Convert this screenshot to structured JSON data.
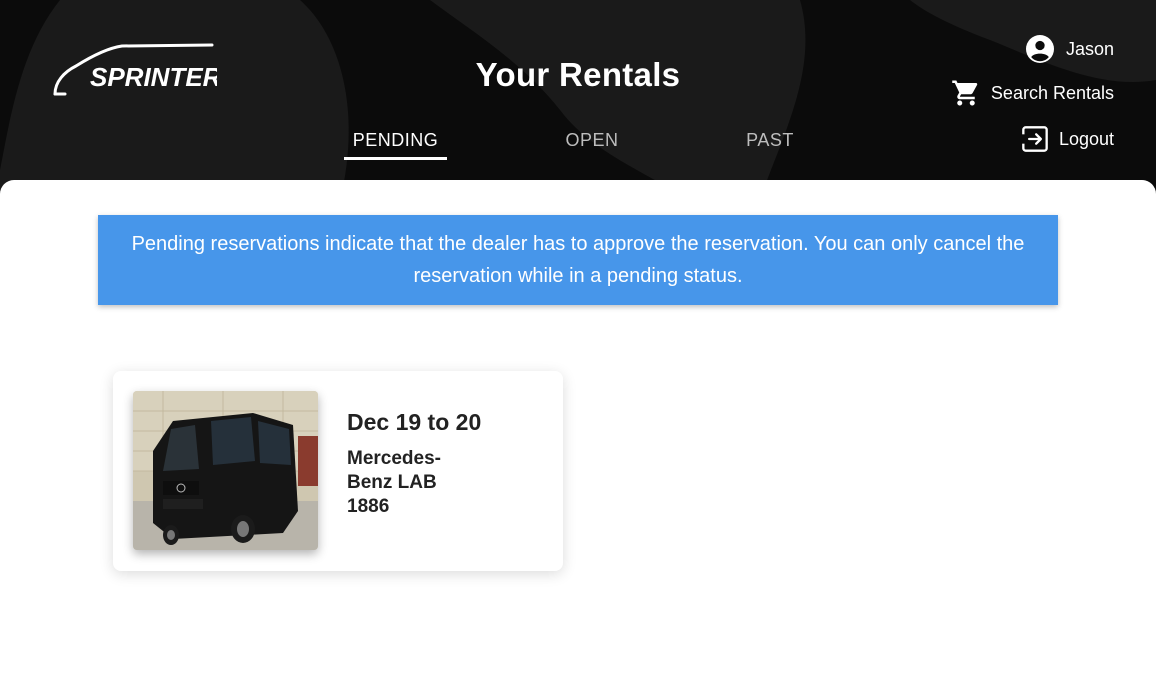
{
  "header": {
    "logo_text": "SPRINTER",
    "title": "Your Rentals",
    "background_color": "#0b0b0b",
    "blob_color": "#1a1a1a"
  },
  "tabs": {
    "items": [
      {
        "label": "PENDING",
        "active": true
      },
      {
        "label": "OPEN",
        "active": false
      },
      {
        "label": "PAST",
        "active": false
      }
    ]
  },
  "user_menu": {
    "username": "Jason",
    "username_icon": "account-circle-icon",
    "search_label": "Search Rentals",
    "search_icon": "cart-icon",
    "logout_label": "Logout",
    "logout_icon": "logout-icon"
  },
  "notice": {
    "text": "Pending reservations indicate that the dealer has to approve the reservation. You can only cancel the reservation while in a pending status.",
    "color": "#4796ea"
  },
  "rentals": [
    {
      "dates": "Dec 19 to 20",
      "vehicle": "Mercedes-Benz LAB 1886"
    }
  ]
}
